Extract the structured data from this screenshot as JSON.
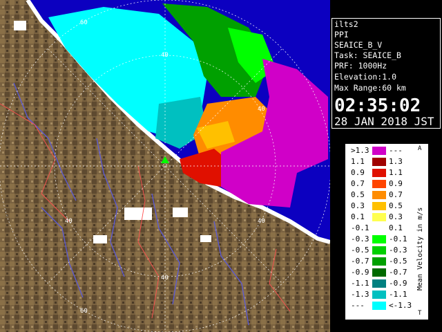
{
  "info": {
    "site": "ilts2",
    "product": "PPI",
    "scan": "SEAICE_B_V",
    "task": "Task: SEAICE_B",
    "prf": "PRF: 1000Hz",
    "elevation": "Elevation:1.0",
    "max_range": "Max Range:60 km",
    "time": "02:35:02",
    "date": "28 JAN 2018 JST"
  },
  "range_labels": [
    "60",
    "40",
    "40",
    "40",
    "40",
    "40",
    "60"
  ],
  "legend": {
    "title": "Mean Velocity in m/s",
    "top_mark": "A",
    "bottom_mark": "T",
    "rows": [
      {
        "left": ">1.3",
        "right": "---",
        "color": "#d000c8"
      },
      {
        "left": "1.1",
        "right": "1.3",
        "color": "#a00000"
      },
      {
        "left": "0.9",
        "right": "1.1",
        "color": "#e01000"
      },
      {
        "left": "0.7",
        "right": "0.9",
        "color": "#ff4400"
      },
      {
        "left": "0.5",
        "right": "0.7",
        "color": "#ff8c00"
      },
      {
        "left": "0.3",
        "right": "0.5",
        "color": "#ffc000"
      },
      {
        "left": "0.1",
        "right": "0.3",
        "color": "#ffff50"
      },
      {
        "left": "-0.1",
        "right": "0.1",
        "color": "#ffffff"
      },
      {
        "left": "-0.3",
        "right": "-0.1",
        "color": "#00ff00"
      },
      {
        "left": "-0.5",
        "right": "-0.3",
        "color": "#00d000"
      },
      {
        "left": "-0.7",
        "right": "-0.5",
        "color": "#00a000"
      },
      {
        "left": "-0.9",
        "right": "-0.7",
        "color": "#006a00"
      },
      {
        "left": "-1.1",
        "right": "-0.9",
        "color": "#008080"
      },
      {
        "left": "-1.3",
        "right": "-1.1",
        "color": "#00c0c0"
      },
      {
        "left": "---",
        "right": "<-1.3",
        "color": "#00ffff"
      }
    ]
  },
  "colors": {
    "sea": "#0c00c0",
    "land": "#7a6240",
    "approach_high": "#d000c8",
    "recede_high": "#00ffff"
  }
}
